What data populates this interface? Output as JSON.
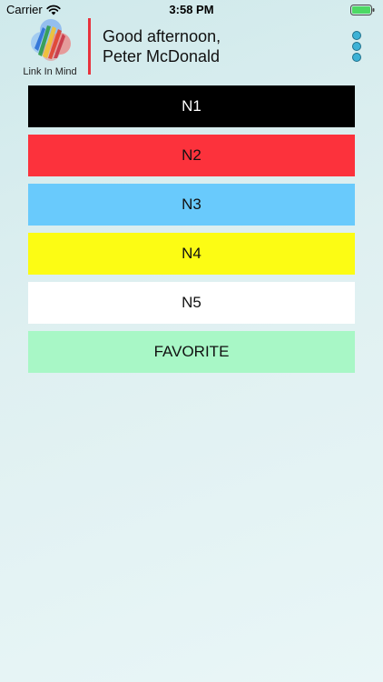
{
  "status_bar": {
    "carrier": "Carrier",
    "time": "3:58 PM",
    "wifi_icon": "wifi-icon",
    "battery_icon": "battery-icon"
  },
  "header": {
    "logo_text": "Link In Mind",
    "greeting_line1": "Good afternoon,",
    "greeting_line2": "Peter McDonald",
    "menu_icon": "more-vertical-icon",
    "divider_color": "#e8323c"
  },
  "categories": [
    {
      "label": "N1",
      "background": "#000000",
      "color": "#ffffff"
    },
    {
      "label": "N2",
      "background": "#fc323c",
      "color": "#111111"
    },
    {
      "label": "N3",
      "background": "#69cafc",
      "color": "#111111"
    },
    {
      "label": "N4",
      "background": "#fcfc14",
      "color": "#111111"
    },
    {
      "label": "N5",
      "background": "#ffffff",
      "color": "#111111"
    },
    {
      "label": "FAVORITE",
      "background": "#a8f7c6",
      "color": "#111111"
    }
  ]
}
